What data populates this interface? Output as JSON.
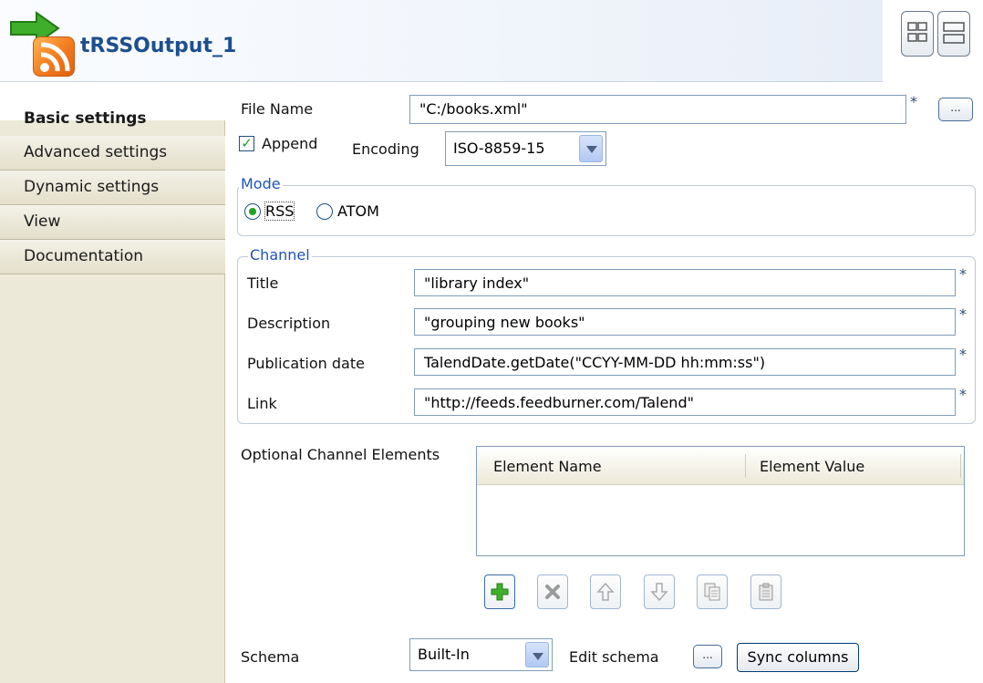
{
  "component": {
    "title": "tRSSOutput_1"
  },
  "sidebar": {
    "tabs": [
      {
        "label": "Basic settings"
      },
      {
        "label": "Advanced settings"
      },
      {
        "label": "Dynamic settings"
      },
      {
        "label": "View"
      },
      {
        "label": "Documentation"
      }
    ]
  },
  "form": {
    "file_name": {
      "label": "File Name",
      "value": "\"C:/books.xml\"",
      "required": "*",
      "browse": "..."
    },
    "append": {
      "label": "Append",
      "checked": true
    },
    "encoding": {
      "label": "Encoding",
      "value": "ISO-8859-15"
    },
    "mode": {
      "legend": "Mode",
      "options": [
        "RSS",
        "ATOM"
      ],
      "selected": "RSS"
    },
    "channel": {
      "legend": "Channel",
      "fields": [
        {
          "label": "Title",
          "value": "\"library index\""
        },
        {
          "label": "Description",
          "value": "\"grouping new books\""
        },
        {
          "label": "Publication date",
          "value": "TalendDate.getDate(\"CCYY-MM-DD hh:mm:ss\")"
        },
        {
          "label": "Link",
          "value": "\"http://feeds.feedburner.com/Talend\""
        }
      ],
      "required": "*"
    },
    "optional_elements": {
      "label": "Optional Channel Elements",
      "columns": [
        "Element Name",
        "Element Value"
      ],
      "rows": []
    },
    "schema": {
      "label": "Schema",
      "value": "Built-In",
      "edit_label": "Edit schema",
      "edit_btn": "...",
      "sync_label": "Sync columns"
    }
  },
  "toolbar_icons": [
    "add-icon",
    "delete-icon",
    "move-up-icon",
    "move-down-icon",
    "copy-icon",
    "paste-icon"
  ]
}
